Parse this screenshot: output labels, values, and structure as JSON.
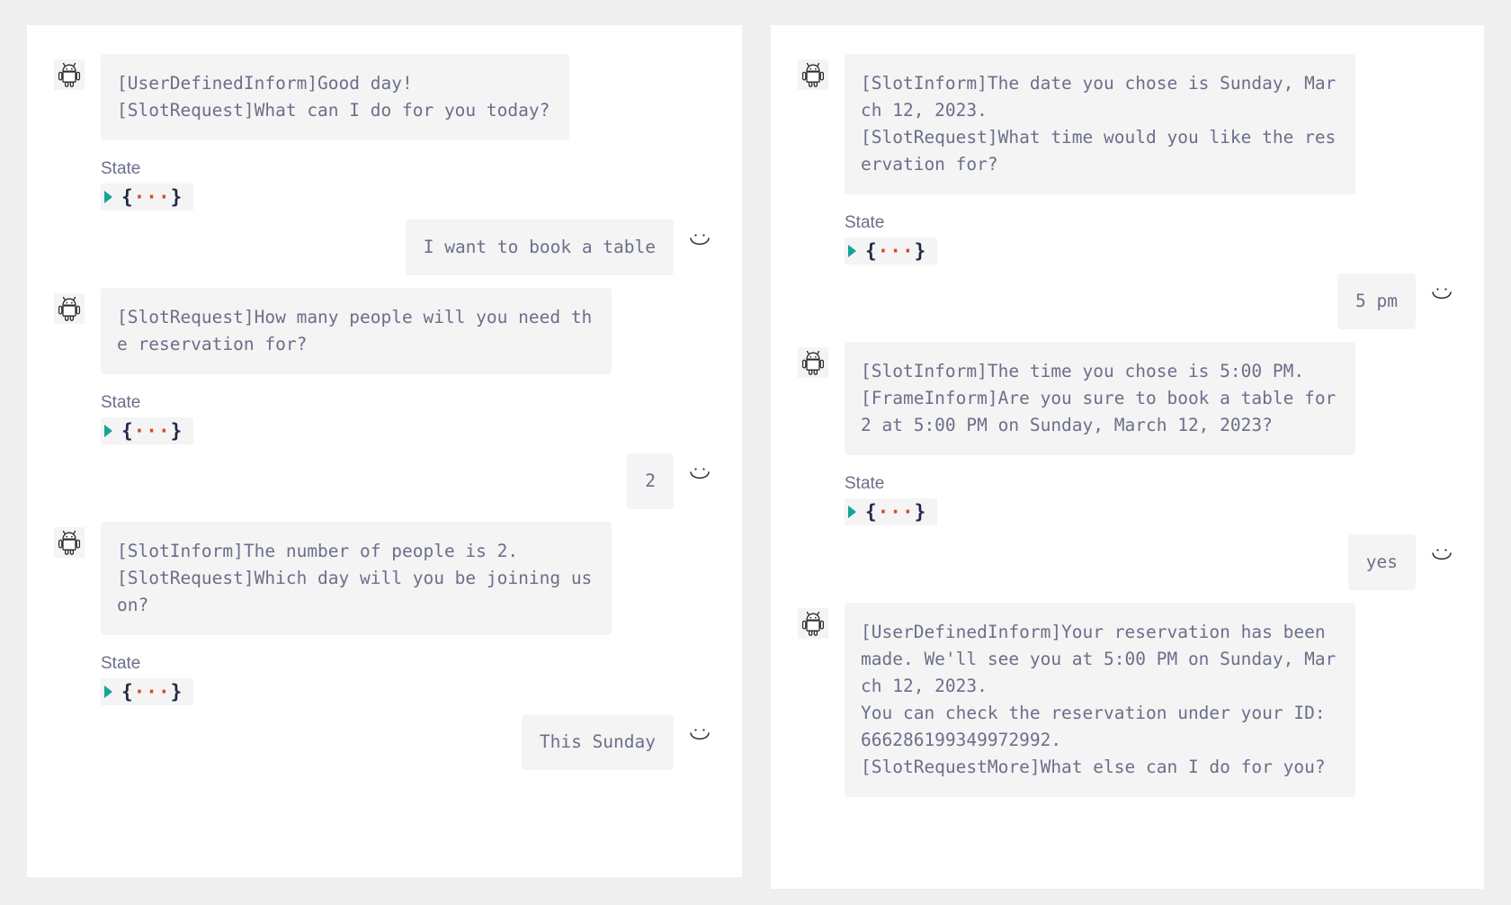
{
  "theme": {
    "page_background": "#efefef",
    "panel_background": "#ffffff",
    "bubble_background": "#f4f4f4",
    "text_color": "#6b6f8a",
    "triangle_color": "#17a398",
    "brace_color": "#1f2847",
    "dot_color": "#d9472b"
  },
  "icons": {
    "bot": "android-robot-icon",
    "user": "smiley-face-icon",
    "expander": "play-triangle-icon"
  },
  "labels": {
    "state": "State",
    "collapsed_object_open": "{",
    "collapsed_object_dots": "···",
    "collapsed_object_close": "}"
  },
  "panels": [
    {
      "id": "left",
      "turns": [
        {
          "role": "bot",
          "text": "[UserDefinedInform]Good day!\n[SlotRequest]What can I do for you today?",
          "state": "State"
        },
        {
          "role": "user",
          "text": "I want to book a table"
        },
        {
          "role": "bot",
          "text": "[SlotRequest]How many people will you need th\ne reservation for?",
          "state": "State"
        },
        {
          "role": "user",
          "text": "2"
        },
        {
          "role": "bot",
          "text": "[SlotInform]The number of people is 2.\n[SlotRequest]Which day will you be joining us\non?",
          "state": "State"
        },
        {
          "role": "user",
          "text": "This Sunday"
        }
      ]
    },
    {
      "id": "right",
      "turns": [
        {
          "role": "bot",
          "text": "[SlotInform]The date you chose is Sunday, Mar\nch 12, 2023.\n[SlotRequest]What time would you like the res\nervation for?",
          "state": "State"
        },
        {
          "role": "user",
          "text": "5 pm"
        },
        {
          "role": "bot",
          "text": "[SlotInform]The time you chose is 5:00 PM.\n[FrameInform]Are you sure to book a table for\n2 at 5:00 PM on Sunday, March 12, 2023?",
          "state": "State"
        },
        {
          "role": "user",
          "text": "yes"
        },
        {
          "role": "bot",
          "text": "[UserDefinedInform]Your reservation has been\nmade. We'll see you at 5:00 PM on Sunday, Mar\nch 12, 2023.\nYou can check the reservation under your ID:\n666286199349972992.\n[SlotRequestMore]What else can I do for you?"
        }
      ]
    }
  ]
}
